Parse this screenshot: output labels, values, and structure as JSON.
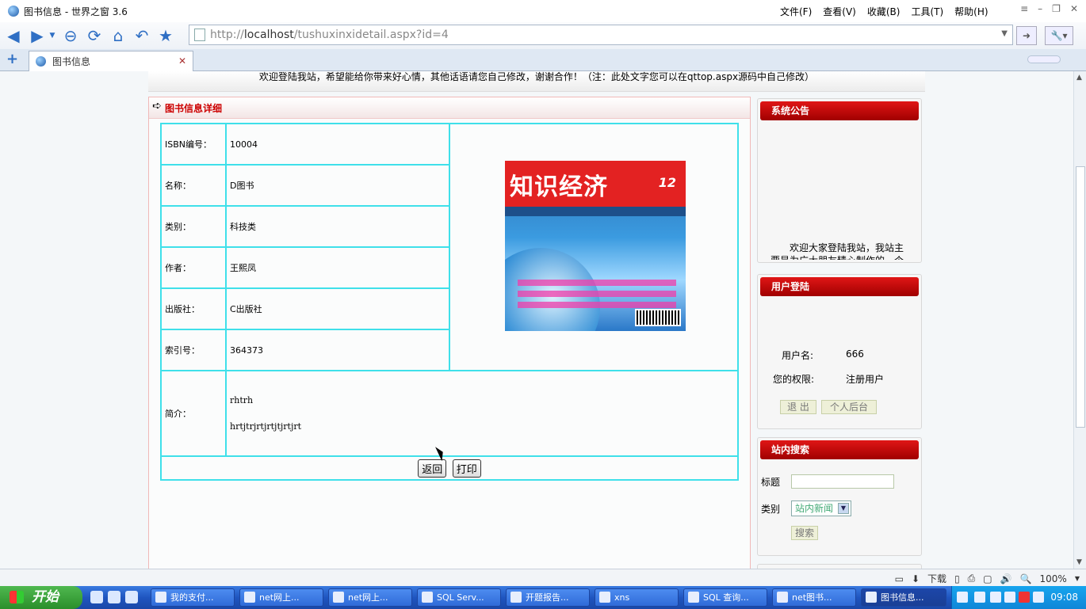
{
  "window": {
    "title": "图书信息 - 世界之窗 3.6",
    "menu": [
      "文件(F)",
      "查看(V)",
      "收藏(B)",
      "工具(T)",
      "帮助(H)"
    ]
  },
  "address": {
    "url_prefix": "http://",
    "url_host": "localhost",
    "url_path": "/tushuxinxidetail.aspx?id=4"
  },
  "tabs": [
    {
      "label": "图书信息"
    }
  ],
  "page": {
    "welcome": "欢迎登陆我站，希望能给你带来好心情，其他话语请您自己修改，谢谢合作！（注：此处文字您可以在qttop.aspx源码中自己修改）",
    "panel_title": "图书信息详细",
    "fields": [
      {
        "label": "ISBN编号：",
        "value": "10004"
      },
      {
        "label": "名称：",
        "value": "D图书"
      },
      {
        "label": "类别：",
        "value": "科技类"
      },
      {
        "label": "作者：",
        "value": "王熙凤"
      },
      {
        "label": "出版社：",
        "value": "C出版社"
      },
      {
        "label": "索引号：",
        "value": "364373"
      }
    ],
    "summary": {
      "label": "简介：",
      "line1": "rhtrh",
      "line2": "hrtjtrjrtjrtjtjrtjrt"
    },
    "cover": {
      "title": "知识经济",
      "issue": "12"
    },
    "buttons": {
      "back": "返回",
      "print": "打印"
    }
  },
  "sidebar": {
    "notice": {
      "title": "系统公告",
      "text": "欢迎大家登陆我站，我站主",
      "text2": "要是为广大朋友精心制作的一个"
    },
    "login": {
      "title": "用户登陆",
      "username_label": "用户名:",
      "username": "666",
      "role_label": "您的权限:",
      "role": "注册用户",
      "logout": "退 出",
      "personal": "个人后台"
    },
    "search": {
      "title": "站内搜索",
      "title_label": "标题",
      "category_label": "类别",
      "category_value": "站内新闻",
      "button": "搜索"
    }
  },
  "status": {
    "download": "下载",
    "zoom": "100%"
  },
  "taskbar": {
    "start": "开始",
    "tasks": [
      "我的支付...",
      "net网上...",
      "net网上...",
      "SQL Serv...",
      "开题报告...",
      "xns",
      "SQL 查询...",
      "net图书...",
      "图书信息..."
    ],
    "clock": "09:08"
  }
}
